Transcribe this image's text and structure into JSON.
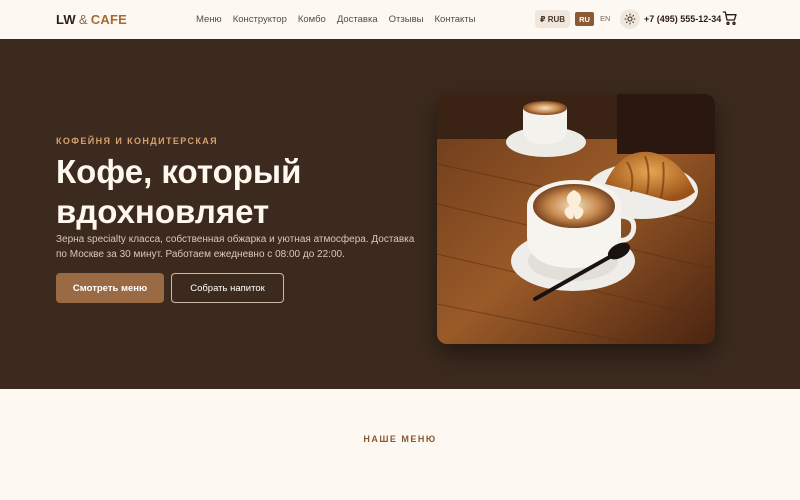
{
  "header": {
    "logo": {
      "lw": "LW",
      "amp": "&",
      "cafe": "CAFE"
    },
    "nav": [
      "Меню",
      "Конструктор",
      "Комбо",
      "Доставка",
      "Отзывы",
      "Контакты"
    ],
    "currency": "₽ RUB",
    "languages": {
      "active": "RU",
      "other": "EN"
    },
    "theme_icon": "sun-icon",
    "phone": "+7 (495) 555-12-34",
    "cart_icon": "cart-icon"
  },
  "hero": {
    "eyebrow": "КОФЕЙНЯ И КОНДИТЕРСКАЯ",
    "title": "Кофе, который вдохновляет",
    "description": "Зерна specialty класса, собственная обжарка и уютная атмосфера. Доставка по Москве за 30 минут. Работаем ежедневно с 08:00 до 22:00.",
    "primary_button": "Смотреть меню",
    "secondary_button": "Собрать напиток"
  },
  "menu_section": {
    "label": "НАШЕ МЕНЮ"
  },
  "colors": {
    "hero_bg": "#3c2a1e",
    "accent": "#9a6a45",
    "page_bg": "#fdf9f2",
    "eyebrow": "#d6a06c"
  }
}
